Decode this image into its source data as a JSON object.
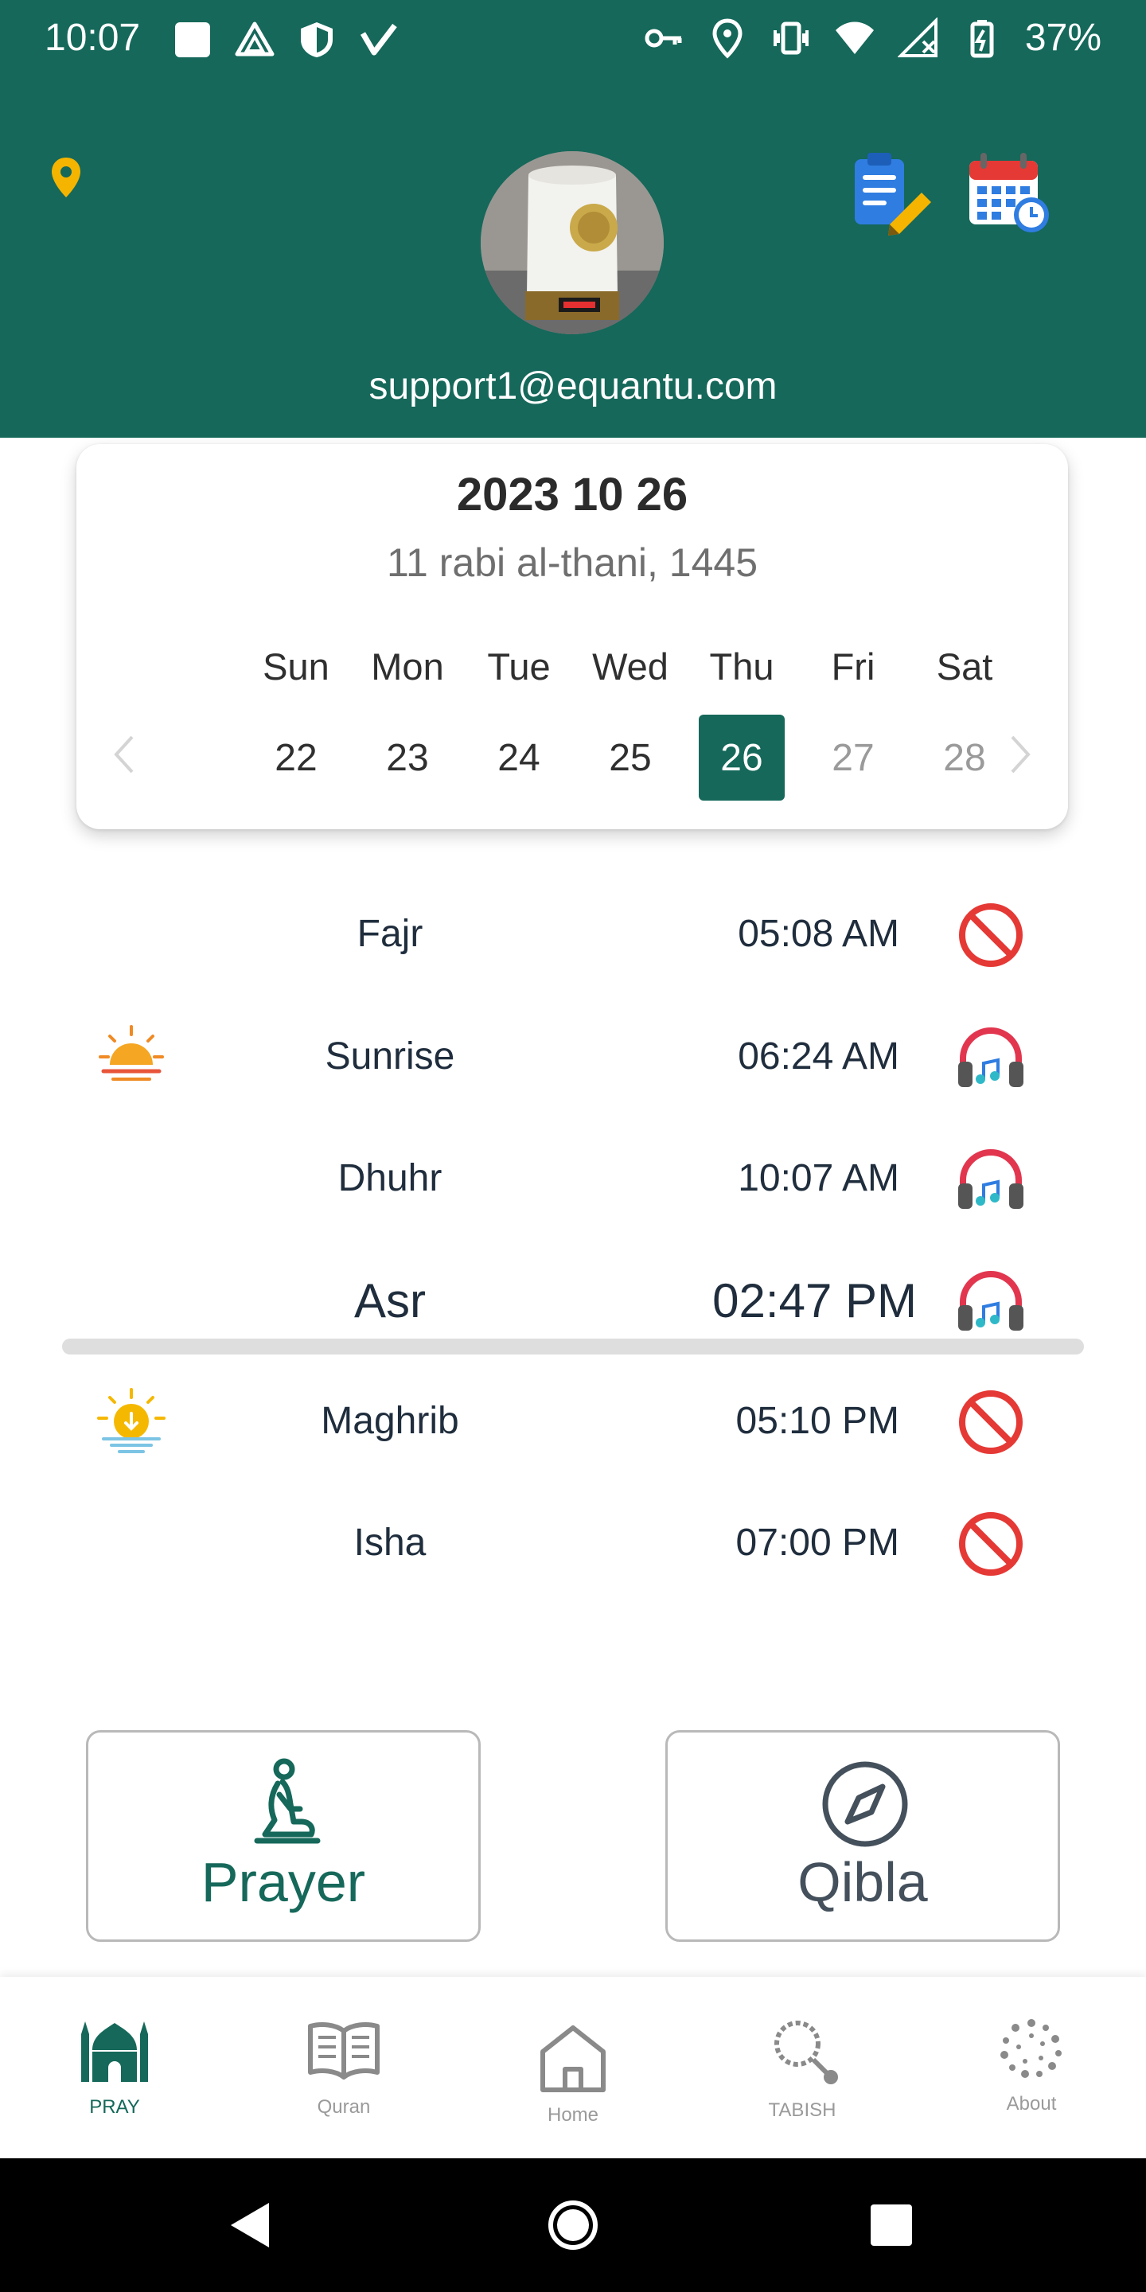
{
  "status_bar": {
    "time": "10:07",
    "battery_percent": "37%",
    "left_icons": [
      "square-icon",
      "drive-icon",
      "shield-icon",
      "verizon-icon"
    ],
    "right_icons": [
      "key-icon",
      "location-icon",
      "vibrate-icon",
      "wifi-icon",
      "signal-icon",
      "battery-icon"
    ]
  },
  "header": {
    "email": "support1@equantu.com",
    "background_color": "#15685a"
  },
  "calendar": {
    "gregorian_date": "2023 10 26",
    "hijri_date": "11 rabi al-thani, 1445",
    "weekdays": [
      "Sun",
      "Mon",
      "Tue",
      "Wed",
      "Thu",
      "Fri",
      "Sat"
    ],
    "days": [
      "22",
      "23",
      "24",
      "25",
      "26",
      "27",
      "28"
    ],
    "selected_day": "26"
  },
  "prayers": [
    {
      "name": "Fajr",
      "time": "05:08 AM",
      "left_icon": "",
      "status_icon": "mute-icon"
    },
    {
      "name": "Sunrise",
      "time": "06:24 AM",
      "left_icon": "sunrise-icon",
      "status_icon": "headphones-icon"
    },
    {
      "name": "Dhuhr",
      "time": "10:07 AM",
      "left_icon": "",
      "status_icon": "headphones-icon"
    },
    {
      "name": "Asr",
      "time": "02:47 PM",
      "left_icon": "",
      "status_icon": "headphones-icon",
      "current": true
    },
    {
      "name": "Maghrib",
      "time": "05:10 PM",
      "left_icon": "sunset-icon",
      "status_icon": "mute-icon"
    },
    {
      "name": "Isha",
      "time": "07:00 PM",
      "left_icon": "",
      "status_icon": "mute-icon"
    }
  ],
  "actions": {
    "prayer_label": "Prayer",
    "qibla_label": "Qibla"
  },
  "bottom_nav": [
    {
      "label": "PRAY",
      "icon": "mosque-icon",
      "active": true
    },
    {
      "label": "Quran",
      "icon": "book-icon",
      "active": false
    },
    {
      "label": "Home",
      "icon": "home-icon",
      "active": false
    },
    {
      "label": "TABISH",
      "icon": "tasbih-icon",
      "active": false
    },
    {
      "label": "About",
      "icon": "about-icon",
      "active": false
    }
  ],
  "colors": {
    "primary": "#15685a",
    "accent_yellow": "#f4b400",
    "mute_red": "#e53935"
  }
}
